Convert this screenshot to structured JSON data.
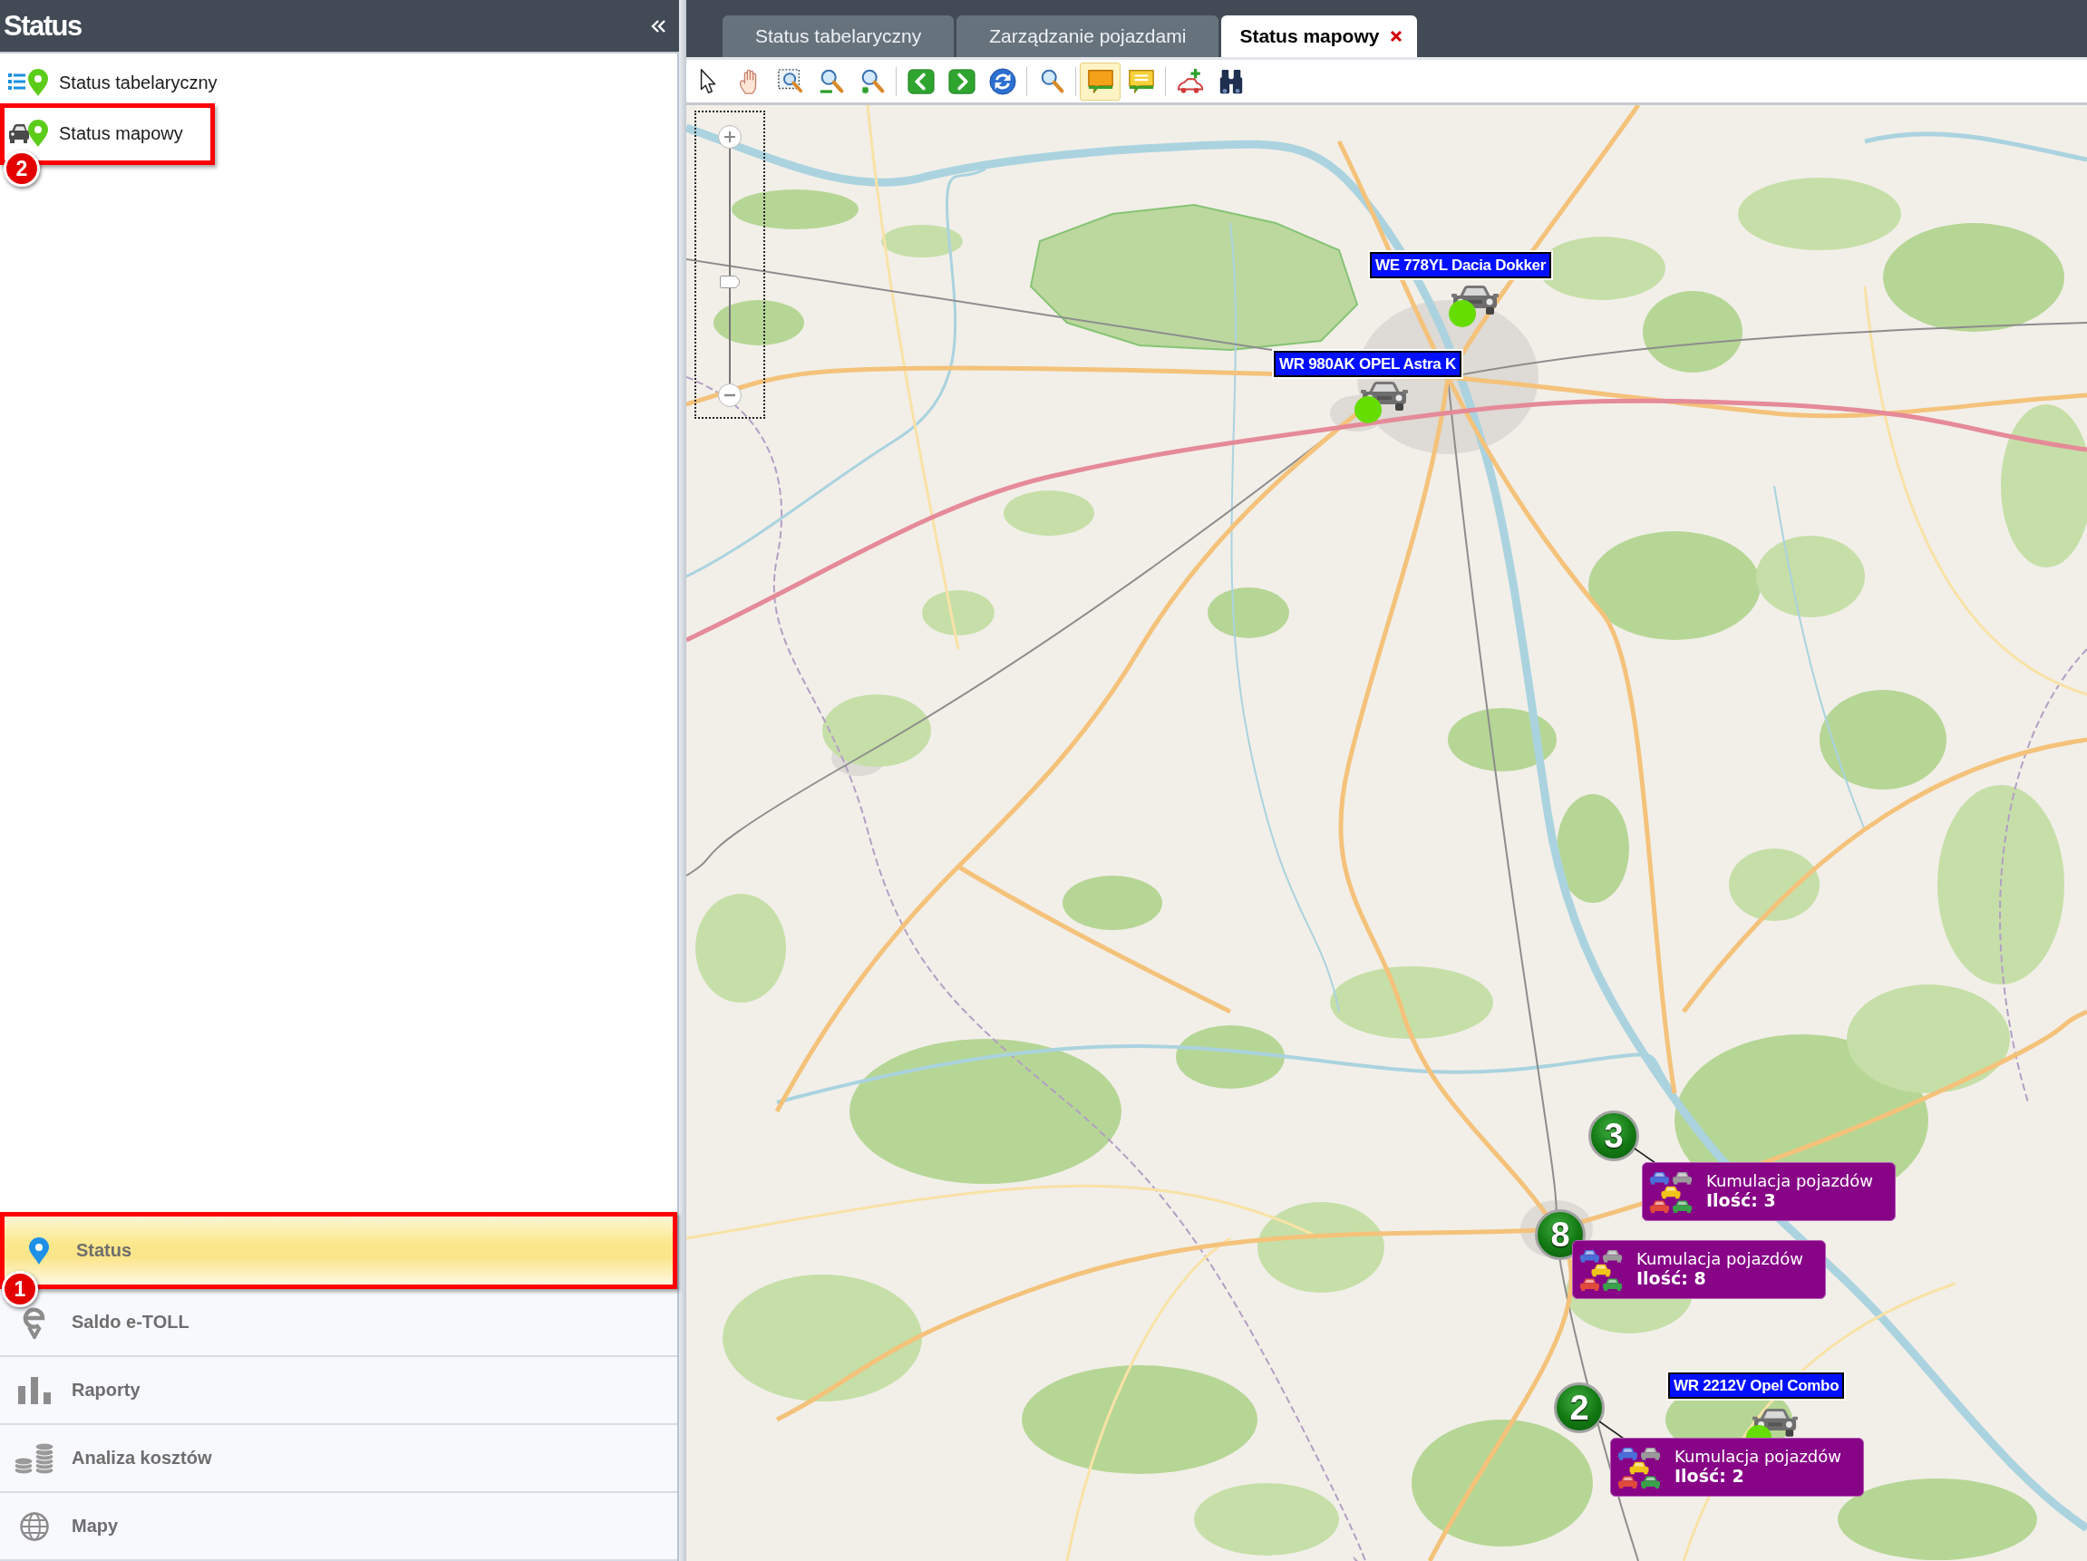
{
  "sidebar": {
    "title": "Status",
    "tree": [
      {
        "label": "Status tabelaryczny",
        "selected": false
      },
      {
        "label": "Status mapowy",
        "selected": false,
        "callout": "2"
      }
    ],
    "nav": [
      {
        "label": "Status",
        "selected": true,
        "callout": "1"
      },
      {
        "label": "Saldo e-TOLL",
        "selected": false
      },
      {
        "label": "Raporty",
        "selected": false
      },
      {
        "label": "Analiza kosztów",
        "selected": false
      },
      {
        "label": "Mapy",
        "selected": false
      }
    ]
  },
  "tabs": [
    {
      "label": "Status tabelaryczny",
      "selected": false,
      "closable": false
    },
    {
      "label": "Zarządzanie pojazdami",
      "selected": false,
      "closable": false
    },
    {
      "label": "Status mapowy",
      "selected": true,
      "closable": true
    }
  ],
  "toolbar": {
    "groups": [
      {
        "buttons": [
          {
            "on": false
          },
          {
            "on": false
          },
          {
            "on": false
          },
          {
            "on": false
          },
          {
            "on": false
          }
        ]
      },
      {
        "buttons": [
          {
            "on": false
          },
          {
            "on": false
          },
          {
            "on": false
          }
        ]
      },
      {
        "buttons": [
          {
            "on": false
          }
        ]
      },
      {
        "buttons": [
          {
            "on": true
          },
          {
            "on": false
          }
        ]
      },
      {
        "buttons": [
          {
            "on": false
          },
          {
            "on": false
          }
        ]
      }
    ]
  },
  "map": {
    "zoom": {
      "level": 0.43
    },
    "vehicles": [
      {
        "label": "WE 778YL Dacia Dokker",
        "color": "#66dd00"
      },
      {
        "label": "WR 980AK OPEL Astra K",
        "color": "#66dd00"
      },
      {
        "label": "WR 2212V Opel Combo",
        "color": "#66dd00"
      }
    ],
    "clusters": [
      {
        "count": "3",
        "title": "Kumulacja pojazdów",
        "quantity": "Ilość: 3"
      },
      {
        "count": "8",
        "title": "Kumulacja pojazdów",
        "quantity": "Ilość: 8"
      },
      {
        "count": "2",
        "title": "Kumulacja pojazdów",
        "quantity": "Ilość: 2"
      }
    ]
  }
}
